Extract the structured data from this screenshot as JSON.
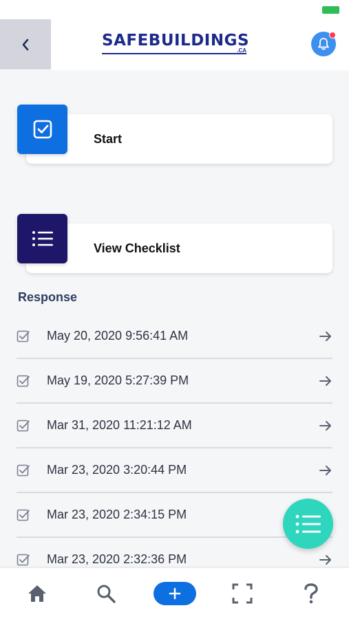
{
  "header": {
    "logo_text": "SAFEBUILDINGS",
    "logo_sub": ".CA",
    "back_icon": "chevron-left-icon",
    "bell_icon": "bell-icon"
  },
  "actions": {
    "start_label": "Start",
    "view_checklist_label": "View Checklist"
  },
  "responses": {
    "title": "Response",
    "items": [
      "May 20, 2020 9:56:41 AM",
      "May 19, 2020 5:27:39 PM",
      "Mar 31, 2020 11:21:12 AM",
      "Mar 23, 2020 3:20:44 PM",
      "Mar 23, 2020 2:34:15 PM",
      "Mar 23, 2020 2:32:36 PM"
    ]
  },
  "bottom_nav": {
    "items": [
      "home-icon",
      "search-icon",
      "add-icon",
      "scan-icon",
      "help-icon"
    ]
  },
  "colors": {
    "brand": "#1d2a8a",
    "start_icon_bg": "#0e6fe0",
    "checklist_icon_bg": "#1e1668",
    "fab": "#2ed6be",
    "bell": "#3d8ff0",
    "notification_dot": "#ff3b4a"
  }
}
